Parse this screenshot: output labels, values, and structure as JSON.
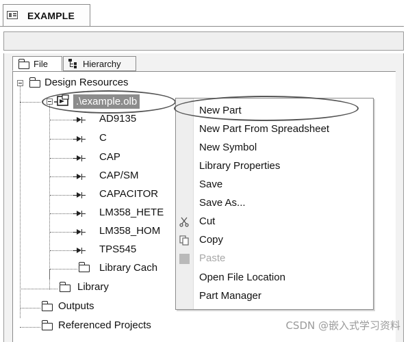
{
  "document_tab": {
    "title": "EXAMPLE",
    "icon": "schematic-page-icon"
  },
  "panel_tabs": [
    {
      "label": "File",
      "icon": "folder-icon",
      "active": true
    },
    {
      "label": "Hierarchy",
      "icon": "hierarchy-icon",
      "active": false
    }
  ],
  "tree": {
    "root": "Design Resources",
    "library_file": ".\\example.olb",
    "parts": [
      "AD9135",
      "C",
      "CAP",
      "CAP/SM",
      "CAPACITOR",
      "LM358_HETE",
      "LM358_HOM",
      "TPS545"
    ],
    "library_cache": "Library Cach",
    "library": "Library",
    "outputs": "Outputs",
    "referenced_projects": "Referenced Projects"
  },
  "context_menu": {
    "items": [
      {
        "label": "New Part",
        "icon": "",
        "enabled": true,
        "highlighted": true
      },
      {
        "label": "New Part From Spreadsheet",
        "icon": "",
        "enabled": true
      },
      {
        "label": "New Symbol",
        "icon": "",
        "enabled": true
      },
      {
        "label": "Library Properties",
        "icon": "",
        "enabled": true
      },
      {
        "label": "Save",
        "icon": "",
        "enabled": true
      },
      {
        "label": "Save As...",
        "icon": "",
        "enabled": true
      },
      {
        "label": "Cut",
        "icon": "scissors-icon",
        "enabled": true
      },
      {
        "label": "Copy",
        "icon": "copy-icon",
        "enabled": true
      },
      {
        "label": "Paste",
        "icon": "paste-icon",
        "enabled": false
      },
      {
        "label": "Open File Location",
        "icon": "",
        "enabled": true
      },
      {
        "label": "Part Manager",
        "icon": "",
        "enabled": true
      }
    ]
  },
  "watermark": "CSDN @嵌入式学习资料",
  "colors": {
    "selection": "#8c8c8c",
    "disabled_text": "#a8a8a8",
    "menu_gutter": "#eeeeee"
  }
}
